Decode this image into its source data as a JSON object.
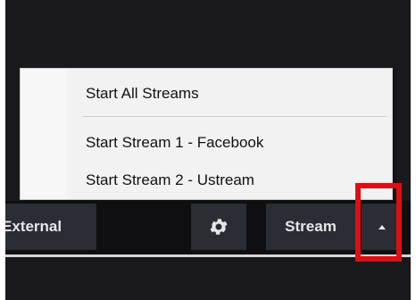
{
  "menu": {
    "items": [
      {
        "label": "Start All Streams"
      },
      {
        "label": "Start Stream 1 - Facebook"
      },
      {
        "label": "Start Stream 2 - Ustream"
      }
    ]
  },
  "toolbar": {
    "external_label": "External",
    "settings_icon": "gear-icon",
    "stream_label": "Stream",
    "dropdown_icon": "caret-up-icon"
  },
  "colors": {
    "highlight": "#e00d12",
    "toolbar_button": "#2b2d35",
    "menu_bg": "#f2f2f2"
  }
}
